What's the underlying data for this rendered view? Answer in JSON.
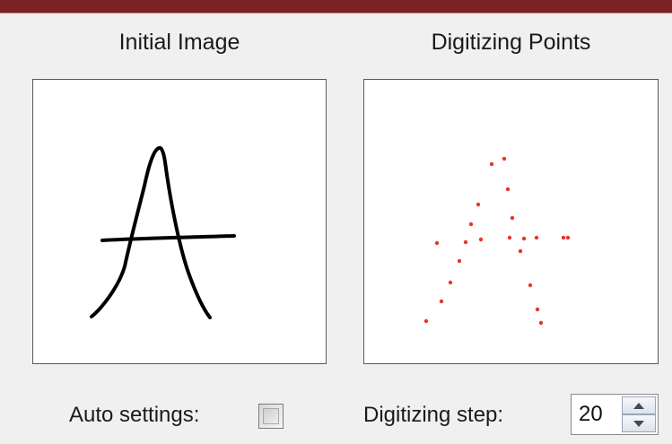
{
  "captions": {
    "initial_image": "Initial Image",
    "digitizing_points": "Digitizing Points"
  },
  "settings": {
    "auto_settings_label": "Auto settings:",
    "auto_settings_checked": false,
    "digitizing_step_label": "Digitizing step:",
    "digitizing_step_value": "20"
  },
  "colors": {
    "title_bar": "#7b2324",
    "stroke": "#000000",
    "point": "#e8342c",
    "panel_border": "#5a5a5a"
  },
  "icons": {
    "spin_up": "up-arrow-icon",
    "spin_down": "down-arrow-icon"
  }
}
